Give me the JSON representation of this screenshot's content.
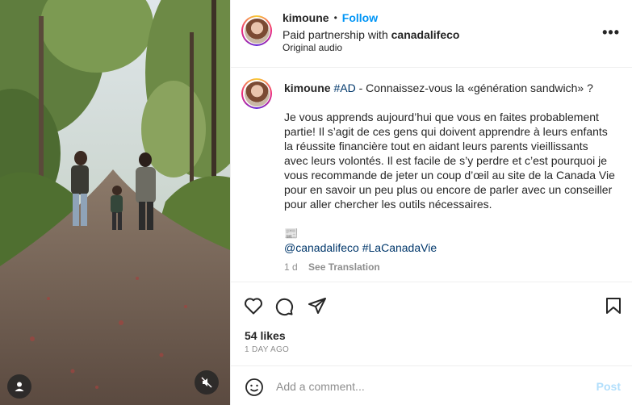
{
  "header": {
    "username": "kimoune",
    "separator": "•",
    "follow_label": "Follow",
    "partnership_prefix": "Paid partnership with ",
    "partner": "canadalifeco",
    "audio": "Original audio",
    "more_label": "•••"
  },
  "caption": {
    "username": "kimoune",
    "hashtag_ad": "#AD",
    "first_line": " - Connaissez-vous la «génération sandwich» ?",
    "paragraph": "Je vous apprends aujourd’hui que vous en faites probablement partie! Il s’agit de ces gens qui doivent apprendre à leurs enfants la réussite financière tout en aidant leurs parents vieillissants avec leurs volontés. Il est facile de s’y perdre et c’est pourquoi je vous recommande de jeter un coup d’œil au site de la Canada Vie pour en savoir un peu plus ou encore de parler avec un conseiller pour aller chercher les outils nécessaires.",
    "emoji_line": "📰",
    "mention": "@canadalifeco",
    "hashtag": "#LaCanadaVie",
    "age": "1 d",
    "see_translation": "See Translation"
  },
  "stats": {
    "likes": "54 likes",
    "time": "1 DAY AGO"
  },
  "comment": {
    "placeholder": "Add a comment...",
    "post_label": "Post"
  },
  "icons": {
    "like": "heart-icon",
    "comment": "comment-icon",
    "share": "share-icon",
    "save": "bookmark-icon",
    "emoji": "emoji-icon",
    "tags": "user-tag-icon",
    "mute": "muted-speaker-icon"
  },
  "colors": {
    "accent": "#0095f6",
    "link": "#00376b",
    "muted_text": "#8e8e8e",
    "post_disabled": "#b2dffc"
  }
}
